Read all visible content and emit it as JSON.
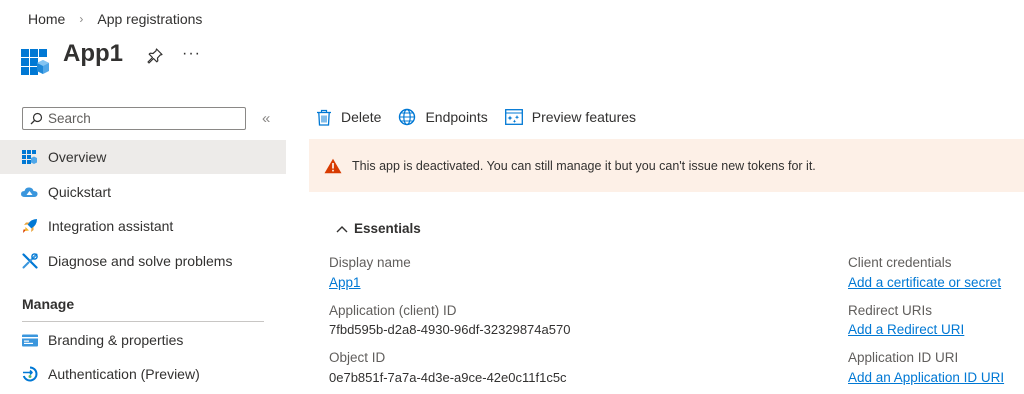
{
  "breadcrumb": {
    "home": "Home",
    "current": "App registrations"
  },
  "app": {
    "title": "App1"
  },
  "search": {
    "placeholder": "Search"
  },
  "sidebar": {
    "items": [
      {
        "label": "Overview",
        "icon": "overview-icon"
      },
      {
        "label": "Quickstart",
        "icon": "quickstart-icon"
      },
      {
        "label": "Integration assistant",
        "icon": "rocket-icon"
      },
      {
        "label": "Diagnose and solve problems",
        "icon": "wrench-icon"
      }
    ],
    "manage_heading": "Manage",
    "manage_items": [
      {
        "label": "Branding & properties",
        "icon": "branding-icon"
      },
      {
        "label": "Authentication (Preview)",
        "icon": "authentication-icon"
      }
    ]
  },
  "toolbar": {
    "delete": "Delete",
    "endpoints": "Endpoints",
    "preview": "Preview features"
  },
  "banner": {
    "text": "This app is deactivated. You can still manage it but you can't issue new tokens for it."
  },
  "essentials": {
    "header": "Essentials",
    "display_name_label": "Display name",
    "display_name_value": "App1",
    "app_id_label": "Application (client) ID",
    "app_id_value": "7fbd595b-d2a8-4930-96df-32329874a570",
    "object_id_label": "Object ID",
    "object_id_value": "0e7b851f-7a7a-4d3e-a9ce-42e0c11f1c5c",
    "client_creds_label": "Client credentials",
    "client_creds_link": "Add a certificate or secret",
    "redirect_label": "Redirect URIs",
    "redirect_link": "Add a Redirect URI",
    "app_id_uri_label": "Application ID URI",
    "app_id_uri_link": "Add an Application ID URI"
  },
  "colors": {
    "accent": "#0078d4",
    "warning": "#d83b01",
    "banner_bg": "#fdf0e7",
    "active_nav": "#edebe9"
  }
}
